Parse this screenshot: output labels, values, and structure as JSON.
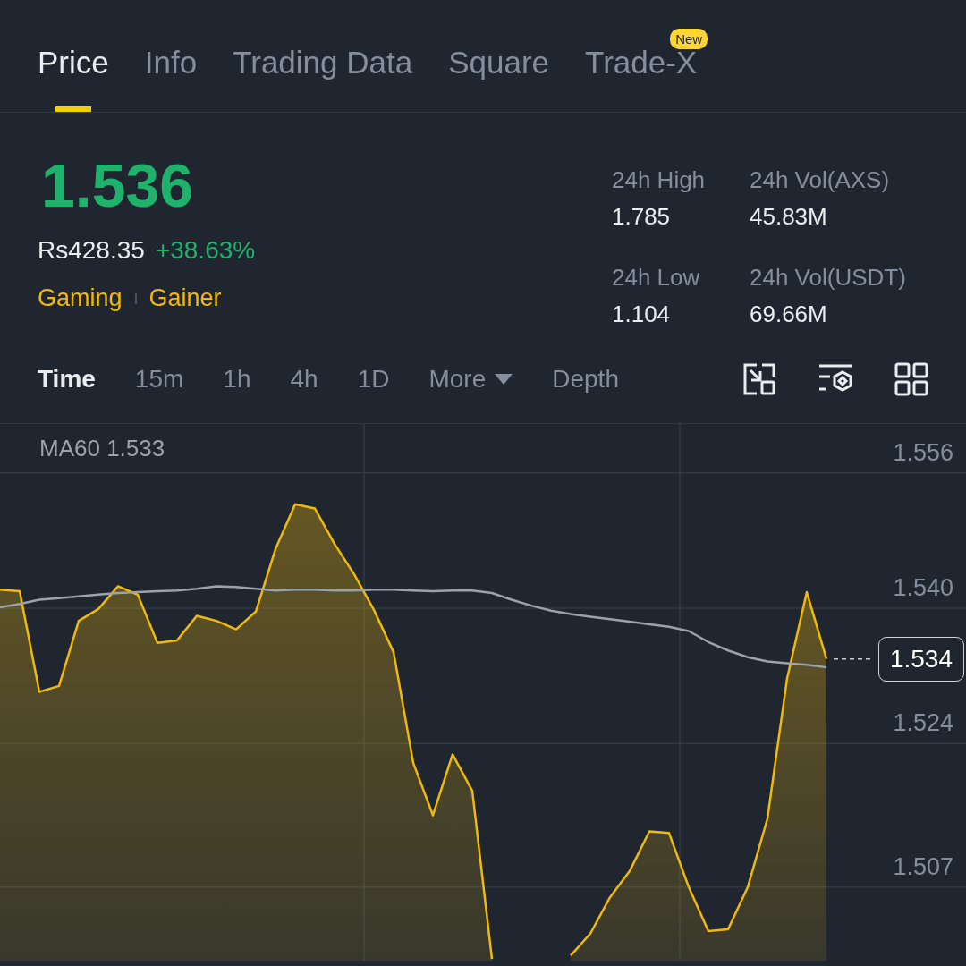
{
  "tabs": [
    {
      "label": "Price",
      "selected": true
    },
    {
      "label": "Info",
      "selected": false
    },
    {
      "label": "Trading Data",
      "selected": false
    },
    {
      "label": "Square",
      "selected": false
    },
    {
      "label": "Trade-X",
      "selected": false,
      "badge": "New"
    }
  ],
  "ticker": {
    "price": "1.536",
    "fiat_price": "Rs428.35",
    "change": "+38.63%",
    "tags": [
      "Gaming",
      "Gainer"
    ]
  },
  "stats": [
    {
      "label": "24h High",
      "value": "1.785"
    },
    {
      "label": "24h Vol(AXS)",
      "value": "45.83M"
    },
    {
      "label": "24h Low",
      "value": "1.104"
    },
    {
      "label": "24h Vol(USDT)",
      "value": "69.66M"
    }
  ],
  "intervals": [
    {
      "label": "Time",
      "selected": true,
      "kind": "plain"
    },
    {
      "label": "15m",
      "selected": false,
      "kind": "plain"
    },
    {
      "label": "1h",
      "selected": false,
      "kind": "plain"
    },
    {
      "label": "4h",
      "selected": false,
      "kind": "plain"
    },
    {
      "label": "1D",
      "selected": false,
      "kind": "plain"
    },
    {
      "label": "More",
      "selected": false,
      "kind": "dropdown"
    },
    {
      "label": "Depth",
      "selected": false,
      "kind": "plain"
    }
  ],
  "chart": {
    "indicator_value": "1.533",
    "last_price_label": "1.534",
    "chart_data": {
      "type": "line",
      "grid": true,
      "ylim": [
        1.4983,
        1.5618
      ],
      "yticks": [
        {
          "value": 1.556,
          "label": "1.556"
        },
        {
          "value": 1.54,
          "label": "1.540"
        },
        {
          "value": 1.524,
          "label": "1.524"
        },
        {
          "value": 1.507,
          "label": "1.507"
        }
      ],
      "series": [
        {
          "type": "area",
          "color": "#f0b90b",
          "values": [
            1.5422,
            1.542,
            1.5301,
            1.5308,
            1.5385,
            1.5399,
            1.5426,
            1.5416,
            1.5359,
            1.5362,
            1.5391,
            1.5385,
            1.5375,
            1.5396,
            1.547,
            1.5523,
            1.5518,
            1.5476,
            1.544,
            1.5398,
            1.5348,
            1.5217,
            1.5155,
            1.5227,
            1.5184,
            1.4985,
            null,
            null,
            null,
            1.4989,
            1.5015,
            1.5058,
            1.5089,
            1.5136,
            1.5134,
            1.507,
            1.5018,
            1.502,
            1.507,
            1.5151,
            1.5317,
            1.5419,
            1.534
          ]
        },
        {
          "name": "MA60",
          "color": "#9aa3ad",
          "values": [
            1.5401,
            1.5405,
            1.541,
            1.5412,
            1.5414,
            1.5416,
            1.5418,
            1.5419,
            1.542,
            1.5421,
            1.5423,
            1.5426,
            1.5425,
            1.5423,
            1.5421,
            1.5422,
            1.5422,
            1.5421,
            1.5421,
            1.5422,
            1.5422,
            1.5421,
            1.542,
            1.5421,
            1.5421,
            1.5418,
            1.541,
            1.5403,
            1.5397,
            1.5393,
            1.539,
            1.5387,
            1.5384,
            1.5381,
            1.5378,
            1.5373,
            1.536,
            1.535,
            1.5342,
            1.5337,
            1.5335,
            1.5333,
            1.533
          ]
        }
      ]
    }
  }
}
